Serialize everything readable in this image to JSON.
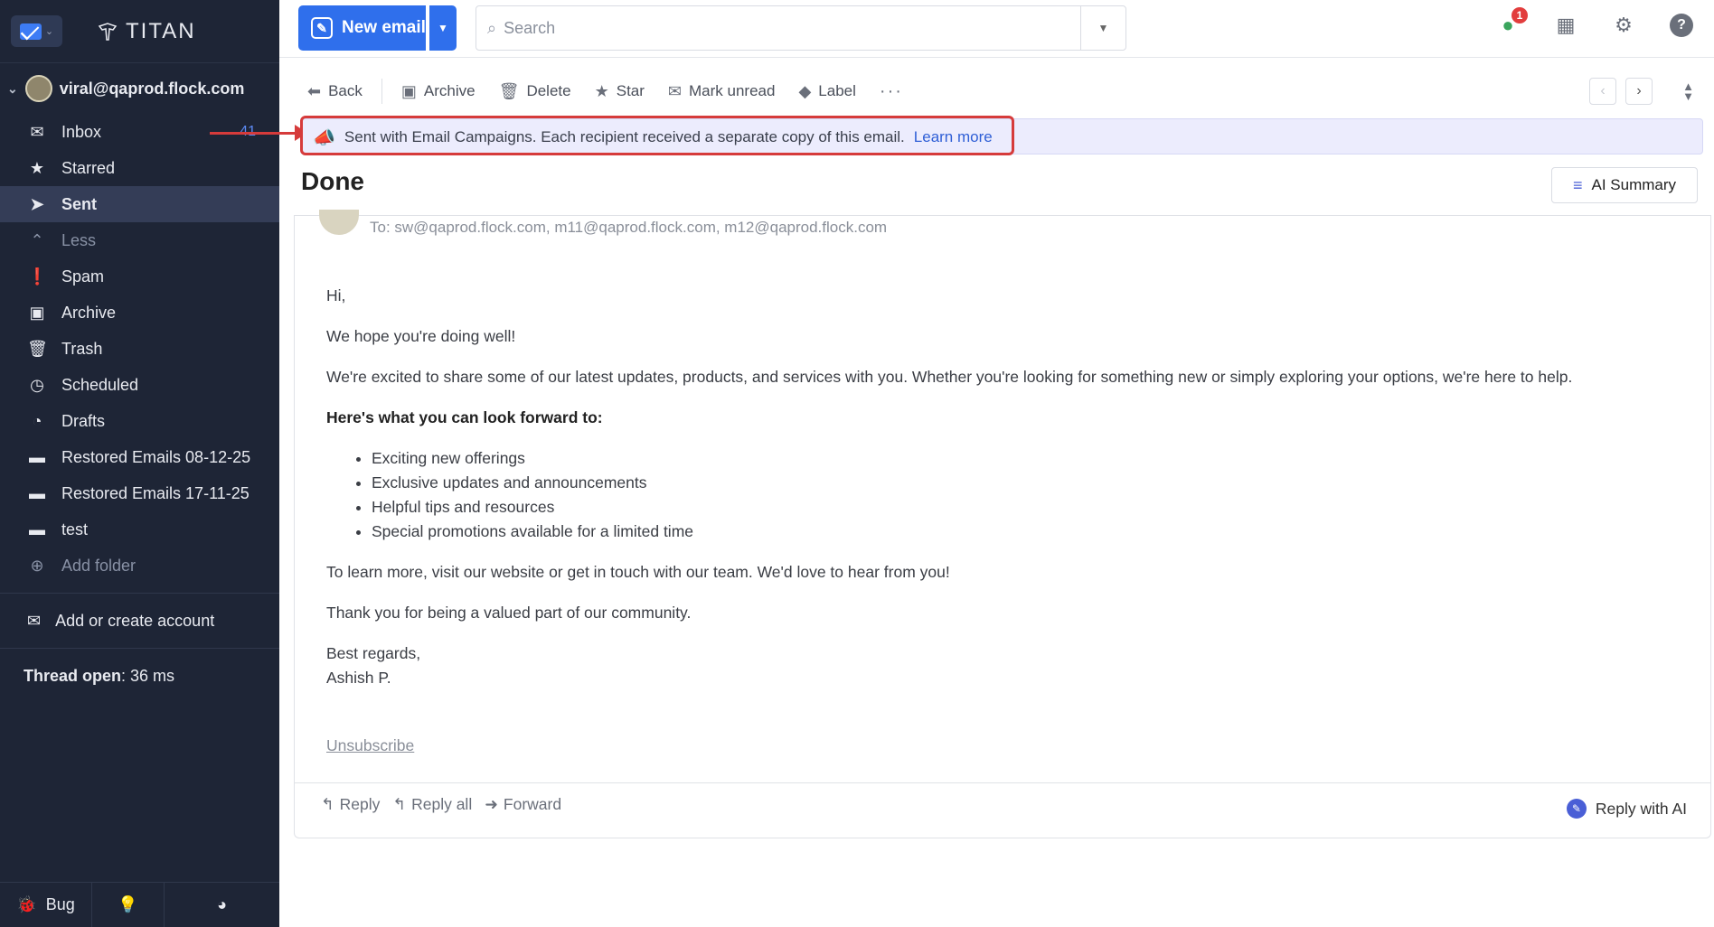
{
  "sidebar": {
    "brand": "TITAN",
    "account": "viral@qaprod.flock.com",
    "items": [
      {
        "label": "Inbox",
        "icon": "inbox-icon",
        "count": "41"
      },
      {
        "label": "Starred",
        "icon": "star-icon"
      },
      {
        "label": "Sent",
        "icon": "send-icon"
      },
      {
        "label": "Less",
        "icon": "chevron-up-icon"
      },
      {
        "label": "Spam",
        "icon": "spam-icon"
      },
      {
        "label": "Archive",
        "icon": "archive-icon"
      },
      {
        "label": "Trash",
        "icon": "trash-icon"
      },
      {
        "label": "Scheduled",
        "icon": "clock-icon"
      },
      {
        "label": "Drafts",
        "icon": "drafts-icon"
      },
      {
        "label": "Restored Emails 08-12-25",
        "icon": "folder-icon"
      },
      {
        "label": "Restored Emails 17-11-25",
        "icon": "folder-icon"
      },
      {
        "label": "test",
        "icon": "folder-icon"
      },
      {
        "label": "Add folder",
        "icon": "plus-circle-icon"
      }
    ],
    "add_account": "Add or create account",
    "thread_open_label": "Thread open",
    "thread_open_value": ": 36 ms",
    "bottom": {
      "bug_label": "Bug"
    }
  },
  "topbar": {
    "new_email": "New email",
    "search_placeholder": "Search",
    "notification_count": "1",
    "help": "?"
  },
  "toolbar": {
    "back": "Back",
    "archive": "Archive",
    "delete": "Delete",
    "star": "Star",
    "mark_unread": "Mark unread",
    "label": "Label",
    "more": "···"
  },
  "banner": {
    "text": "Sent with Email Campaigns. Each recipient received a separate copy of this email.",
    "link": "Learn more"
  },
  "email": {
    "subject": "Done",
    "ai_summary": "AI Summary",
    "to": "To: sw@qaprod.flock.com, m11@qaprod.flock.com, m12@qaprod.flock.com",
    "greeting": "Hi,",
    "p1": "We hope you're doing well!",
    "p2": "We're excited to share some of our latest updates, products, and services with you. Whether you're looking for something new or simply exploring your options, we're here to help.",
    "bold_heading": "Here's what you can look forward to:",
    "bullets": [
      "Exciting new offerings",
      "Exclusive updates and announcements",
      "Helpful tips and resources",
      "Special promotions available for a limited time"
    ],
    "p3": "To learn more, visit our website or get in touch with our team. We'd love to hear from you!",
    "p4": "Thank you for being a valued part of our community.",
    "signoff": "Best regards,",
    "signature": "Ashish P.",
    "unsubscribe": "Unsubscribe"
  },
  "reply_bar": {
    "reply": "Reply",
    "reply_all": "Reply all",
    "forward": "Forward",
    "reply_ai": "Reply with AI"
  },
  "colors": {
    "sidebar_bg": "#1e2536",
    "accent": "#2f6fec",
    "annotation": "#d63b3b",
    "banner_bg": "#ececfd"
  }
}
